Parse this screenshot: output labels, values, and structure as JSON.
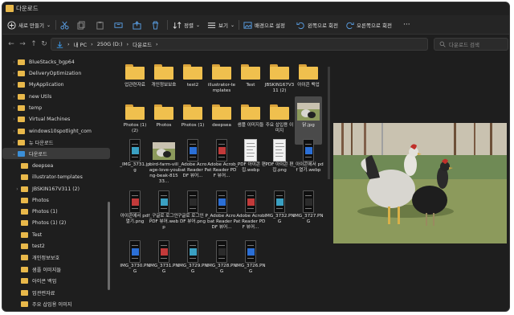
{
  "window": {
    "title": "다운로드"
  },
  "toolbar": {
    "new_label": "새로 만들기",
    "sort_label": "정렬",
    "view_label": "보기",
    "set_bg_label": "배경으로 설정",
    "rotate_left_label": "왼쪽으로 회전",
    "rotate_right_label": "오른쪽으로 회전",
    "more_label": "···"
  },
  "address": {
    "path": [
      "내 PC",
      "250G (D:)",
      "다운로드"
    ],
    "sep": "›",
    "search_placeholder": "다운로드 검색"
  },
  "sidebar": {
    "items": [
      {
        "label": "BlueStacks_bgp64",
        "type": "folder"
      },
      {
        "label": "DeliveryOptimization",
        "type": "folder"
      },
      {
        "label": "MyApplication",
        "type": "folder"
      },
      {
        "label": "new Utils",
        "type": "folder"
      },
      {
        "label": "temp",
        "type": "folder"
      },
      {
        "label": "Virtual Machines",
        "type": "folder"
      },
      {
        "label": "windows10spotlight_com",
        "type": "folder"
      },
      {
        "label": "뉴 다운로드",
        "type": "folder"
      },
      {
        "label": "다운로드",
        "type": "download"
      },
      {
        "label": "deepsea",
        "type": "folder"
      },
      {
        "label": "illustrator-templates",
        "type": "folder"
      },
      {
        "label": "JBSKIN167V311 (2)",
        "type": "folder"
      },
      {
        "label": "Photos",
        "type": "folder"
      },
      {
        "label": "Photos (1)",
        "type": "folder"
      },
      {
        "label": "Photos (1) (2)",
        "type": "folder"
      },
      {
        "label": "Test",
        "type": "folder"
      },
      {
        "label": "test2",
        "type": "folder"
      },
      {
        "label": "개인정보보호",
        "type": "folder"
      },
      {
        "label": "샘플 이미지들",
        "type": "folder"
      },
      {
        "label": "아이콘 백업",
        "type": "folder"
      },
      {
        "label": "업관련자료",
        "type": "folder"
      },
      {
        "label": "주요 삽입용 이미지",
        "type": "folder"
      },
      {
        "label": "다운로드",
        "type": "folder"
      }
    ]
  },
  "files": [
    {
      "label": "업관련자료",
      "kind": "folder"
    },
    {
      "label": "개인정보보호",
      "kind": "folder"
    },
    {
      "label": "test2",
      "kind": "folder"
    },
    {
      "label": "illustrator-templates",
      "kind": "folder"
    },
    {
      "label": "Test",
      "kind": "folder"
    },
    {
      "label": "JBSKIN167V311 (2)",
      "kind": "folder"
    },
    {
      "label": "아이콘 백업",
      "kind": "folder"
    },
    {
      "label": "Photos (1) (2)",
      "kind": "folder"
    },
    {
      "label": "Photos",
      "kind": "folder"
    },
    {
      "label": "Photos (1)",
      "kind": "folder"
    },
    {
      "label": "deepsea",
      "kind": "folder"
    },
    {
      "label": "샘플 이미지들",
      "kind": "folder"
    },
    {
      "label": "주요 삽입용 이미지",
      "kind": "folder"
    },
    {
      "label": "닭.jpg",
      "kind": "photo"
    },
    {
      "label": "_IMG_3731.jpg",
      "kind": "phone"
    },
    {
      "label": "bird-farm-village-love-young-beak-81533...",
      "kind": "photo"
    },
    {
      "label": "_Adobe Acrobat Reader PDF 뷰어...",
      "kind": "phone"
    },
    {
      "label": "Adobe Acrobat Reader PDF 뷰어...",
      "kind": "phone"
    },
    {
      "label": "_PDF 아이콘 편집.webp",
      "kind": "doc"
    },
    {
      "label": "PDF 아이콘 편집.png",
      "kind": "doc"
    },
    {
      "label": "_아이콘에서 pdf 열기.webp",
      "kind": "phone"
    },
    {
      "label": "아이콘에서 pdf 열기.png",
      "kind": "phone"
    },
    {
      "label": "_구글로 로그인 PDF 뷰어.webp",
      "kind": "phone"
    },
    {
      "label": "구글로 로그인 PDF 뷰어.png",
      "kind": "phone"
    },
    {
      "label": "_Adobe Acrobat Reader PDF 뷰어...",
      "kind": "phone"
    },
    {
      "label": "Adobe Acrobat Reader PDF 뷰어...",
      "kind": "phone"
    },
    {
      "label": "IMG_3732.PNG",
      "kind": "phone"
    },
    {
      "label": "IMG_3727.PNG",
      "kind": "phone"
    },
    {
      "label": "IMG_3730.PNG",
      "kind": "phone"
    },
    {
      "label": "IMG_3731.PNG",
      "kind": "phone"
    },
    {
      "label": "IMG_3729.PNG",
      "kind": "phone"
    },
    {
      "label": "IMG_3728.PNG",
      "kind": "phone"
    },
    {
      "label": "IMG_3726.PNG",
      "kind": "phone"
    }
  ],
  "colors": {
    "folder": "#f0c04e",
    "bg": "#1e1e1e",
    "accent": "#3b8fd8"
  }
}
